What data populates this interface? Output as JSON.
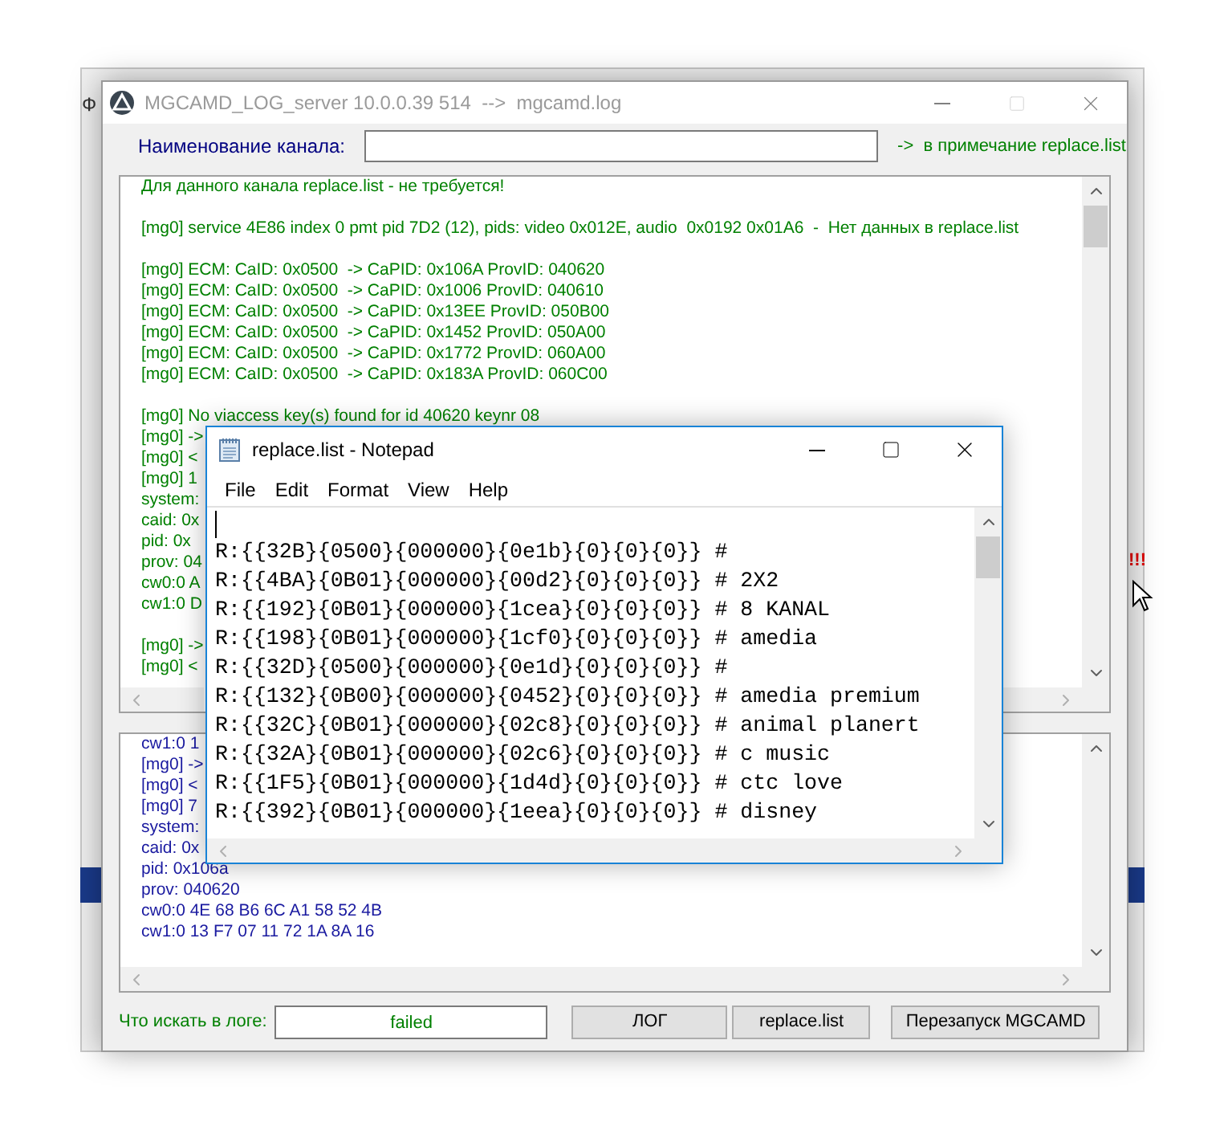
{
  "background": {
    "left_text": "Ф",
    "right_text": "!!!"
  },
  "main_window": {
    "title": "MGCAMD_LOG_server 10.0.0.39 514  -->  mgcamd.log"
  },
  "channel_row": {
    "label": "Наименование канала:",
    "note": "->  в примечание replace.list"
  },
  "log_panel": {
    "paragraphs": [
      [
        "Для данного канала replace.list - не требуется!"
      ],
      [
        "[mg0] service 4E86 index 0 pmt pid 7D2 (12), pids: video 0x012E, audio  0x0192 0x01A6  -  Нет данных в replace.list"
      ],
      [
        "[mg0] ECM: CaID: 0x0500  -> CaPID: 0x106A ProvID: 040620",
        "[mg0] ECM: CaID: 0x0500  -> CaPID: 0x1006 ProvID: 040610",
        "[mg0] ECM: CaID: 0x0500  -> CaPID: 0x13EE ProvID: 050B00",
        "[mg0] ECM: CaID: 0x0500  -> CaPID: 0x1452 ProvID: 050A00",
        "[mg0] ECM: CaID: 0x0500  -> CaPID: 0x1772 ProvID: 060A00",
        "[mg0] ECM: CaID: 0x0500  -> CaPID: 0x183A ProvID: 060C00"
      ],
      [
        "[mg0] No viaccess key(s) found for id 40620 keynr 08",
        "[mg0] ->",
        "[mg0] <",
        "[mg0] 1",
        "system:",
        "caid: 0x",
        "pid: 0x",
        "prov: 04",
        "cw0:0 A",
        "cw1:0 D"
      ],
      [
        "[mg0] ->",
        "[mg0] <"
      ]
    ]
  },
  "detail_panel": {
    "paragraphs": [
      [
        "cw1:0 1",
        "[mg0] ->",
        "[mg0] <",
        "[mg0] 7",
        "system:",
        "caid: 0x",
        "pid: 0x106a",
        "prov: 040620",
        "cw0:0 4E 68 B6 6C A1 58 52 4B",
        "cw1:0 13 F7 07 11 72 1A 8A 16"
      ]
    ]
  },
  "search_row": {
    "label": "Что искать в логе:",
    "value": "failed",
    "buttons": [
      "ЛОГ",
      "replace.list",
      "Перезапуск MGCAMD"
    ]
  },
  "notepad": {
    "title": "replace.list - Notepad",
    "menu": [
      "File",
      "Edit",
      "Format",
      "View",
      "Help"
    ],
    "lines": [
      "R:{{32B}{0500}{000000}{0e1b}{0}{0}{0}} #",
      "R:{{4BA}{0B01}{000000}{00d2}{0}{0}{0}} # 2X2",
      "R:{{192}{0B01}{000000}{1cea}{0}{0}{0}} # 8 KANAL",
      "R:{{198}{0B01}{000000}{1cf0}{0}{0}{0}} # amedia",
      "R:{{32D}{0500}{000000}{0e1d}{0}{0}{0}} #",
      "R:{{132}{0B00}{000000}{0452}{0}{0}{0}} # amedia premium",
      "R:{{32C}{0B01}{000000}{02c8}{0}{0}{0}} # animal planert",
      "R:{{32A}{0B01}{000000}{02c6}{0}{0}{0}} # c music",
      "R:{{1F5}{0B01}{000000}{1d4d}{0}{0}{0}} # ctc love",
      "R:{{392}{0B01}{000000}{1eea}{0}{0}{0}} # disney"
    ]
  }
}
